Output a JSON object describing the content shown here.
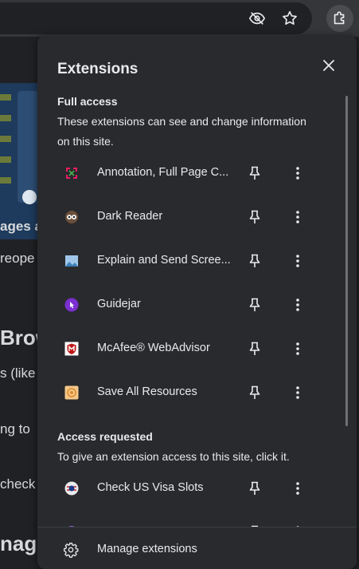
{
  "toolbar": {
    "eye_icon": "eye-off-icon",
    "star_icon": "bookmark-star-icon",
    "extensions_icon": "puzzle-icon"
  },
  "background_page": {
    "lines": [
      "ages a",
      "reope",
      "Brow",
      "s (like",
      "ng to",
      "check",
      "nage"
    ]
  },
  "popup": {
    "title": "Extensions",
    "close_icon": "close-icon",
    "full_access": {
      "heading": "Full access",
      "description": "These extensions can see and change information on this site."
    },
    "full_access_items": [
      {
        "name": "Annotation, Full Page C...",
        "icon": "annotation-icon"
      },
      {
        "name": "Dark Reader",
        "icon": "dark-reader-icon"
      },
      {
        "name": "Explain and Send Scree...",
        "icon": "screenshot-icon"
      },
      {
        "name": "Guidejar",
        "icon": "guidejar-icon"
      },
      {
        "name": "McAfee® WebAdvisor",
        "icon": "mcafee-icon"
      },
      {
        "name": "Save All Resources",
        "icon": "save-resources-icon"
      }
    ],
    "access_requested": {
      "heading": "Access requested",
      "description": "To give an extension access to this site, click it."
    },
    "access_requested_items": [
      {
        "name": "Check US Visa Slots",
        "icon": "visa-slots-icon"
      }
    ],
    "footer": {
      "label": "Manage extensions",
      "icon": "gear-icon"
    }
  }
}
